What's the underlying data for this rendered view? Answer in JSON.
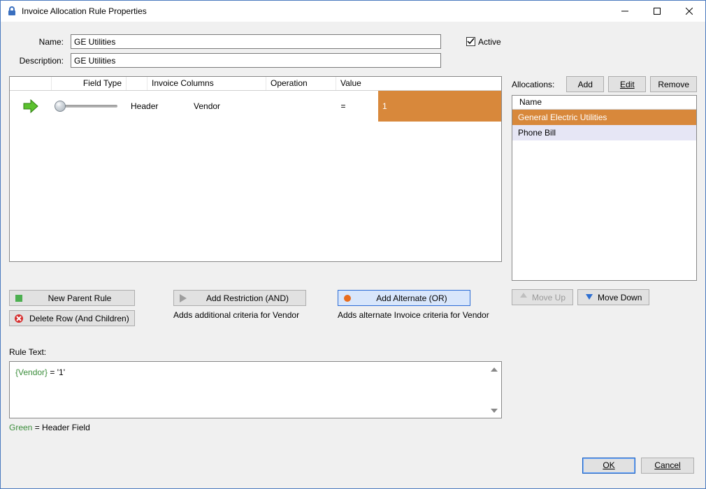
{
  "window": {
    "title": "Invoice Allocation Rule Properties"
  },
  "form": {
    "name_label": "Name:",
    "name_value": "GE Utilities",
    "desc_label": "Description:",
    "desc_value": "GE Utilities",
    "active_label": "Active",
    "active_checked": true
  },
  "grid": {
    "headers": {
      "field_type": "Field Type",
      "invoice_columns": "Invoice Columns",
      "operation": "Operation",
      "value": "Value"
    },
    "row": {
      "field_type": "Header",
      "invoice_column": "Vendor",
      "operation": "=",
      "value": "1"
    }
  },
  "rule_buttons": {
    "new_parent": "New Parent Rule",
    "delete_row": "Delete Row (And Children)",
    "add_restriction": "Add Restriction (AND)",
    "add_restriction_hint": "Adds additional criteria for Vendor",
    "add_alternate": "Add Alternate (OR)",
    "add_alternate_hint": "Adds alternate Invoice criteria for Vendor"
  },
  "allocations": {
    "label": "Allocations:",
    "add": "Add",
    "edit": "Edit",
    "remove": "Remove",
    "name_header": "Name",
    "items": [
      "General Electric Utilities",
      "Phone Bill"
    ],
    "move_up": "Move Up",
    "move_down": "Move Down"
  },
  "rule_text": {
    "label": "Rule Text:",
    "vendor_token": "{Vendor}",
    "rest": " = '1'",
    "legend_green": "Green",
    "legend_rest": "  = Header Field"
  },
  "footer": {
    "ok": "OK",
    "cancel": "Cancel"
  }
}
